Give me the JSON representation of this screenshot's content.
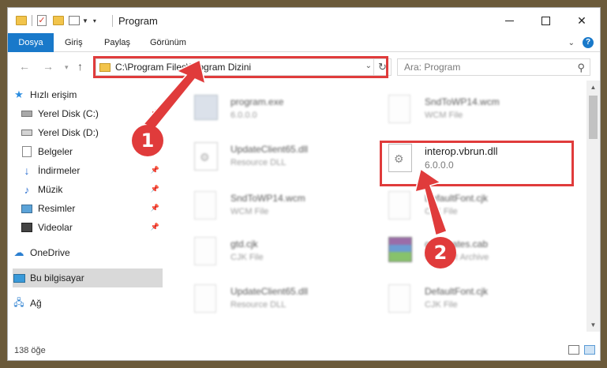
{
  "window": {
    "title": "Program",
    "quick_access_icons": [
      "folder-icon",
      "properties-check-icon",
      "new-folder-icon",
      "customize-icon"
    ]
  },
  "ribbon": {
    "tabs": [
      "Dosya",
      "Giriş",
      "Paylaş",
      "Görünüm"
    ],
    "help": "?"
  },
  "address": {
    "path": "C:\\Program Files\\Program Dizini",
    "search_placeholder": "Ara: Program"
  },
  "sidebar": {
    "items": [
      {
        "label": "Hızlı erişim",
        "icon": "star-icon"
      },
      {
        "label": "Yerel Disk (C:)",
        "icon": "drive-icon",
        "pinned": true
      },
      {
        "label": "Yerel Disk (D:)",
        "icon": "drive-icon",
        "pinned": true
      },
      {
        "label": "Belgeler",
        "icon": "documents-icon",
        "pinned": true
      },
      {
        "label": "İndirmeler",
        "icon": "download-icon",
        "pinned": true
      },
      {
        "label": "Müzik",
        "icon": "music-icon",
        "pinned": true
      },
      {
        "label": "Resimler",
        "icon": "pictures-icon",
        "pinned": true
      },
      {
        "label": "Videolar",
        "icon": "videos-icon",
        "pinned": true
      },
      {
        "label": "OneDrive",
        "icon": "onedrive-icon"
      },
      {
        "label": "Bu bilgisayar",
        "icon": "computer-icon",
        "selected": true
      },
      {
        "label": "Ağ",
        "icon": "network-icon"
      }
    ]
  },
  "files": [
    {
      "name": "program.exe",
      "sub": "6.0.0.0",
      "icon": "exe-icon"
    },
    {
      "name": "SndToWP14.wcm",
      "sub": "WCM File",
      "icon": "file-icon"
    },
    {
      "name": "UpdateClient65.dll",
      "sub": "Resource DLL",
      "icon": "dll-icon"
    },
    {
      "name": "interop.vbrun.dll",
      "sub": "6.0.0.0",
      "icon": "dll-icon"
    },
    {
      "name": "SndToWP14.wcm",
      "sub": "WCM File",
      "icon": "file-icon"
    },
    {
      "name": "DefaultFont.cjk",
      "sub": "CJK File",
      "icon": "file-icon"
    },
    {
      "name": "gtd.cjk",
      "sub": "CJK File",
      "icon": "file-icon"
    },
    {
      "name": "certificates.cab",
      "sub": "WinRAR Archive",
      "icon": "archive-icon"
    },
    {
      "name": "UpdateClient65.dll",
      "sub": "Resource DLL",
      "icon": "dll-icon"
    },
    {
      "name": "DefaultFont.cjk",
      "sub": "CJK File",
      "icon": "file-icon"
    }
  ],
  "status": {
    "item_count": "138 öğe"
  },
  "annotations": {
    "step1": "1",
    "step2": "2",
    "highlight_color": "#e03b3b"
  },
  "colors": {
    "accent": "#1979ca"
  }
}
